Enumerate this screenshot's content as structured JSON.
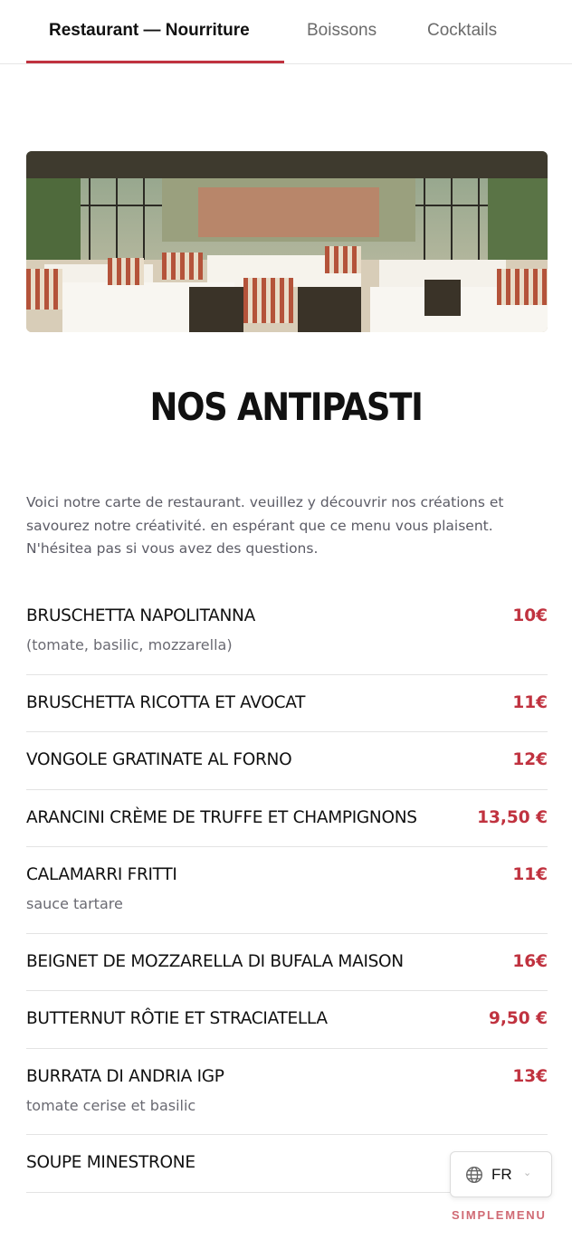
{
  "tabs": [
    {
      "label": "Restaurant — Nourriture",
      "active": true
    },
    {
      "label": "Boissons",
      "active": false
    },
    {
      "label": "Cocktails",
      "active": false
    }
  ],
  "section": {
    "title": "NOS ANTIPASTI",
    "intro": "Voici notre carte de restaurant. veuillez y découvrir nos créations et savourez notre créativité. en espérant que ce menu vous plaisent. N'hésitea pas si vous avez des questions."
  },
  "items": [
    {
      "name": "BRUSCHETTA NAPOLITANNA",
      "price": "10€",
      "desc": "(tomate, basilic, mozzarella)"
    },
    {
      "name": "BRUSCHETTA RICOTTA ET AVOCAT",
      "price": "11€",
      "desc": ""
    },
    {
      "name": "VONGOLE GRATINATE AL FORNO",
      "price": "12€",
      "desc": ""
    },
    {
      "name": "ARANCINI CRÈME DE TRUFFE ET CHAMPIGNONS",
      "price": "13,50 €",
      "desc": ""
    },
    {
      "name": "CALAMARRI FRITTI",
      "price": "11€",
      "desc": "sauce tartare"
    },
    {
      "name": "BEIGNET DE MOZZARELLA DI BUFALA MAISON",
      "price": "16€",
      "desc": ""
    },
    {
      "name": "BUTTERNUT RÔTIE ET STRACIATELLA",
      "price": "9,50 €",
      "desc": ""
    },
    {
      "name": "BURRATA DI ANDRIA IGP",
      "price": "13€",
      "desc": "tomate cerise et basilic"
    },
    {
      "name": "SOUPE MINESTRONE",
      "price": "",
      "desc": ""
    }
  ],
  "language": {
    "code": "FR",
    "icon": "globe-icon"
  },
  "brand": "SIMPLEMENU",
  "colors": {
    "accent": "#c0323f",
    "brand": "#d06a74"
  }
}
